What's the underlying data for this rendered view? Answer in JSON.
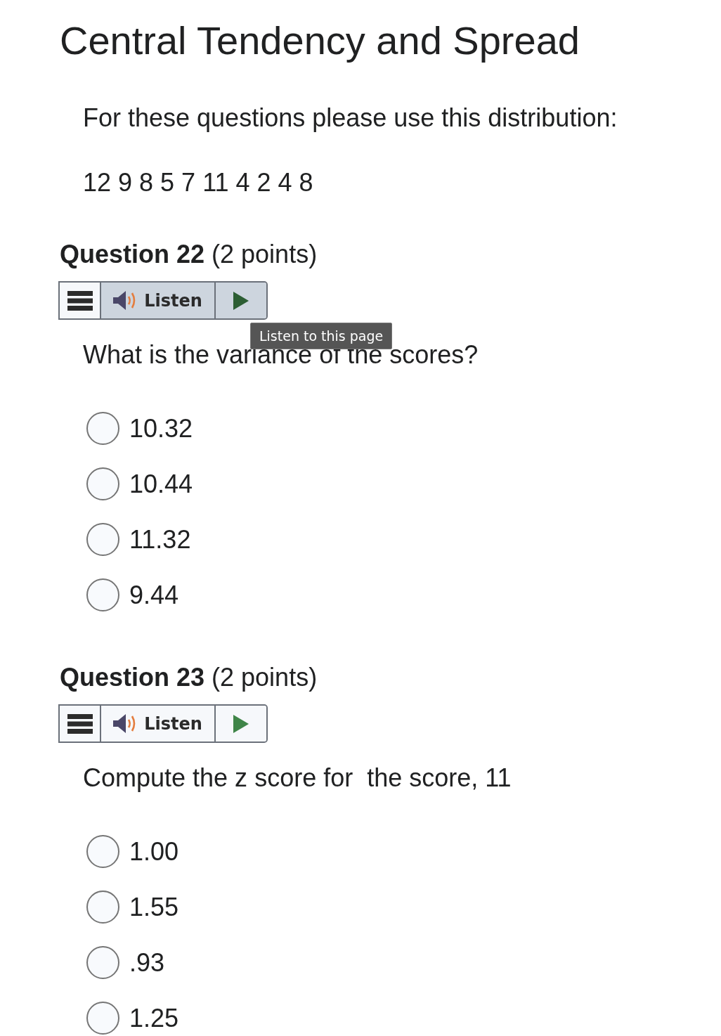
{
  "title": "Central Tendency and Spread",
  "intro": {
    "text": "For these questions please use this distribution:",
    "distribution": "12 9 8 5 7 11 4 2 4 8"
  },
  "questions": [
    {
      "heading": "**Question 22** (2 points)",
      "toolbar": {
        "listen_label": "Listen",
        "hovered": true,
        "tooltip": "Listen to this page"
      },
      "prompt": "What is the variance of the scores?",
      "options": [
        {
          "label": "10.32",
          "selected": false
        },
        {
          "label": "10.44",
          "selected": false
        },
        {
          "label": "11.32",
          "selected": false
        },
        {
          "label": "9.44",
          "selected": false
        }
      ]
    },
    {
      "heading": "**Question 23** (2 points)",
      "toolbar": {
        "listen_label": "Listen",
        "hovered": false
      },
      "prompt": "Compute the z score for  the score, 11",
      "options": [
        {
          "label": "1.00",
          "selected": false
        },
        {
          "label": "1.55",
          "selected": false
        },
        {
          "label": ".93",
          "selected": false
        },
        {
          "label": "1.25",
          "selected": false
        }
      ]
    }
  ]
}
